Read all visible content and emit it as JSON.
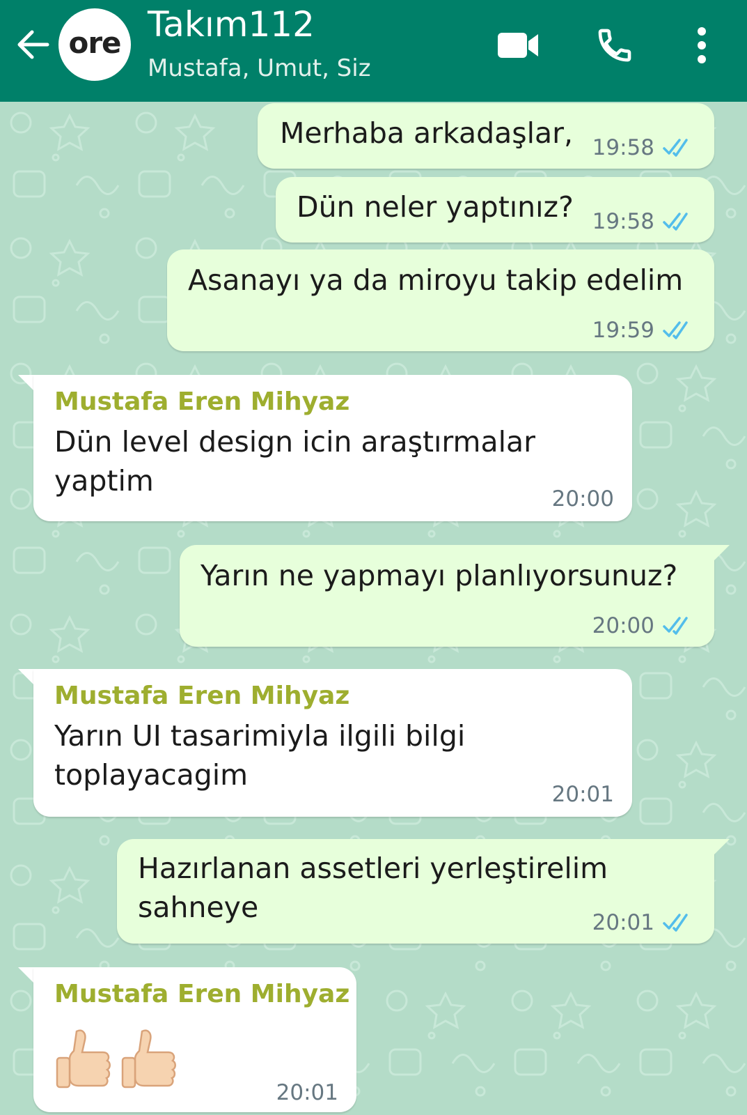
{
  "header": {
    "back_icon": "arrow-left-icon",
    "avatar_text": "ore",
    "title": "Takım112",
    "subtitle": "Mustafa, Umut, Siz",
    "video_icon": "video-camera-icon",
    "call_icon": "phone-icon",
    "menu_icon": "more-vertical-icon",
    "color": "#008069"
  },
  "colors": {
    "outgoing_bubble": "#e7ffdb",
    "incoming_bubble": "#ffffff",
    "sender_name": "#9eae2f",
    "read_ticks": "#53bdeb",
    "wallpaper": "#b4dcc8"
  },
  "messages": [
    {
      "direction": "out",
      "text": "Merhaba arkadaşlar,",
      "time": "19:58",
      "status": "read"
    },
    {
      "direction": "out",
      "text": "Dün neler yaptınız?",
      "time": "19:58",
      "status": "read"
    },
    {
      "direction": "out",
      "text": "Asanayı ya da miroyu takip edelim",
      "time": "19:59",
      "status": "read"
    },
    {
      "direction": "in",
      "sender": "Mustafa Eren Mihyaz",
      "lines": [
        "Dün level design icin araştırmalar",
        "yaptim"
      ],
      "time": "20:00"
    },
    {
      "direction": "out",
      "text": "Yarın ne yapmayı planlıyorsunuz?",
      "time": "20:00",
      "status": "read"
    },
    {
      "direction": "in",
      "sender": "Mustafa Eren Mihyaz",
      "lines": [
        "Yarın UI tasarimiyla ilgili bilgi",
        "toplayacagim"
      ],
      "time": "20:01"
    },
    {
      "direction": "out",
      "lines": [
        "Hazırlanan assetleri yerleştirelim",
        "sahneye"
      ],
      "time": "20:01",
      "status": "read"
    },
    {
      "direction": "in",
      "sender": "Mustafa Eren Mihyaz",
      "emoji": "thumbs-up-icon",
      "emoji_count": 2,
      "time": "20:01"
    }
  ]
}
